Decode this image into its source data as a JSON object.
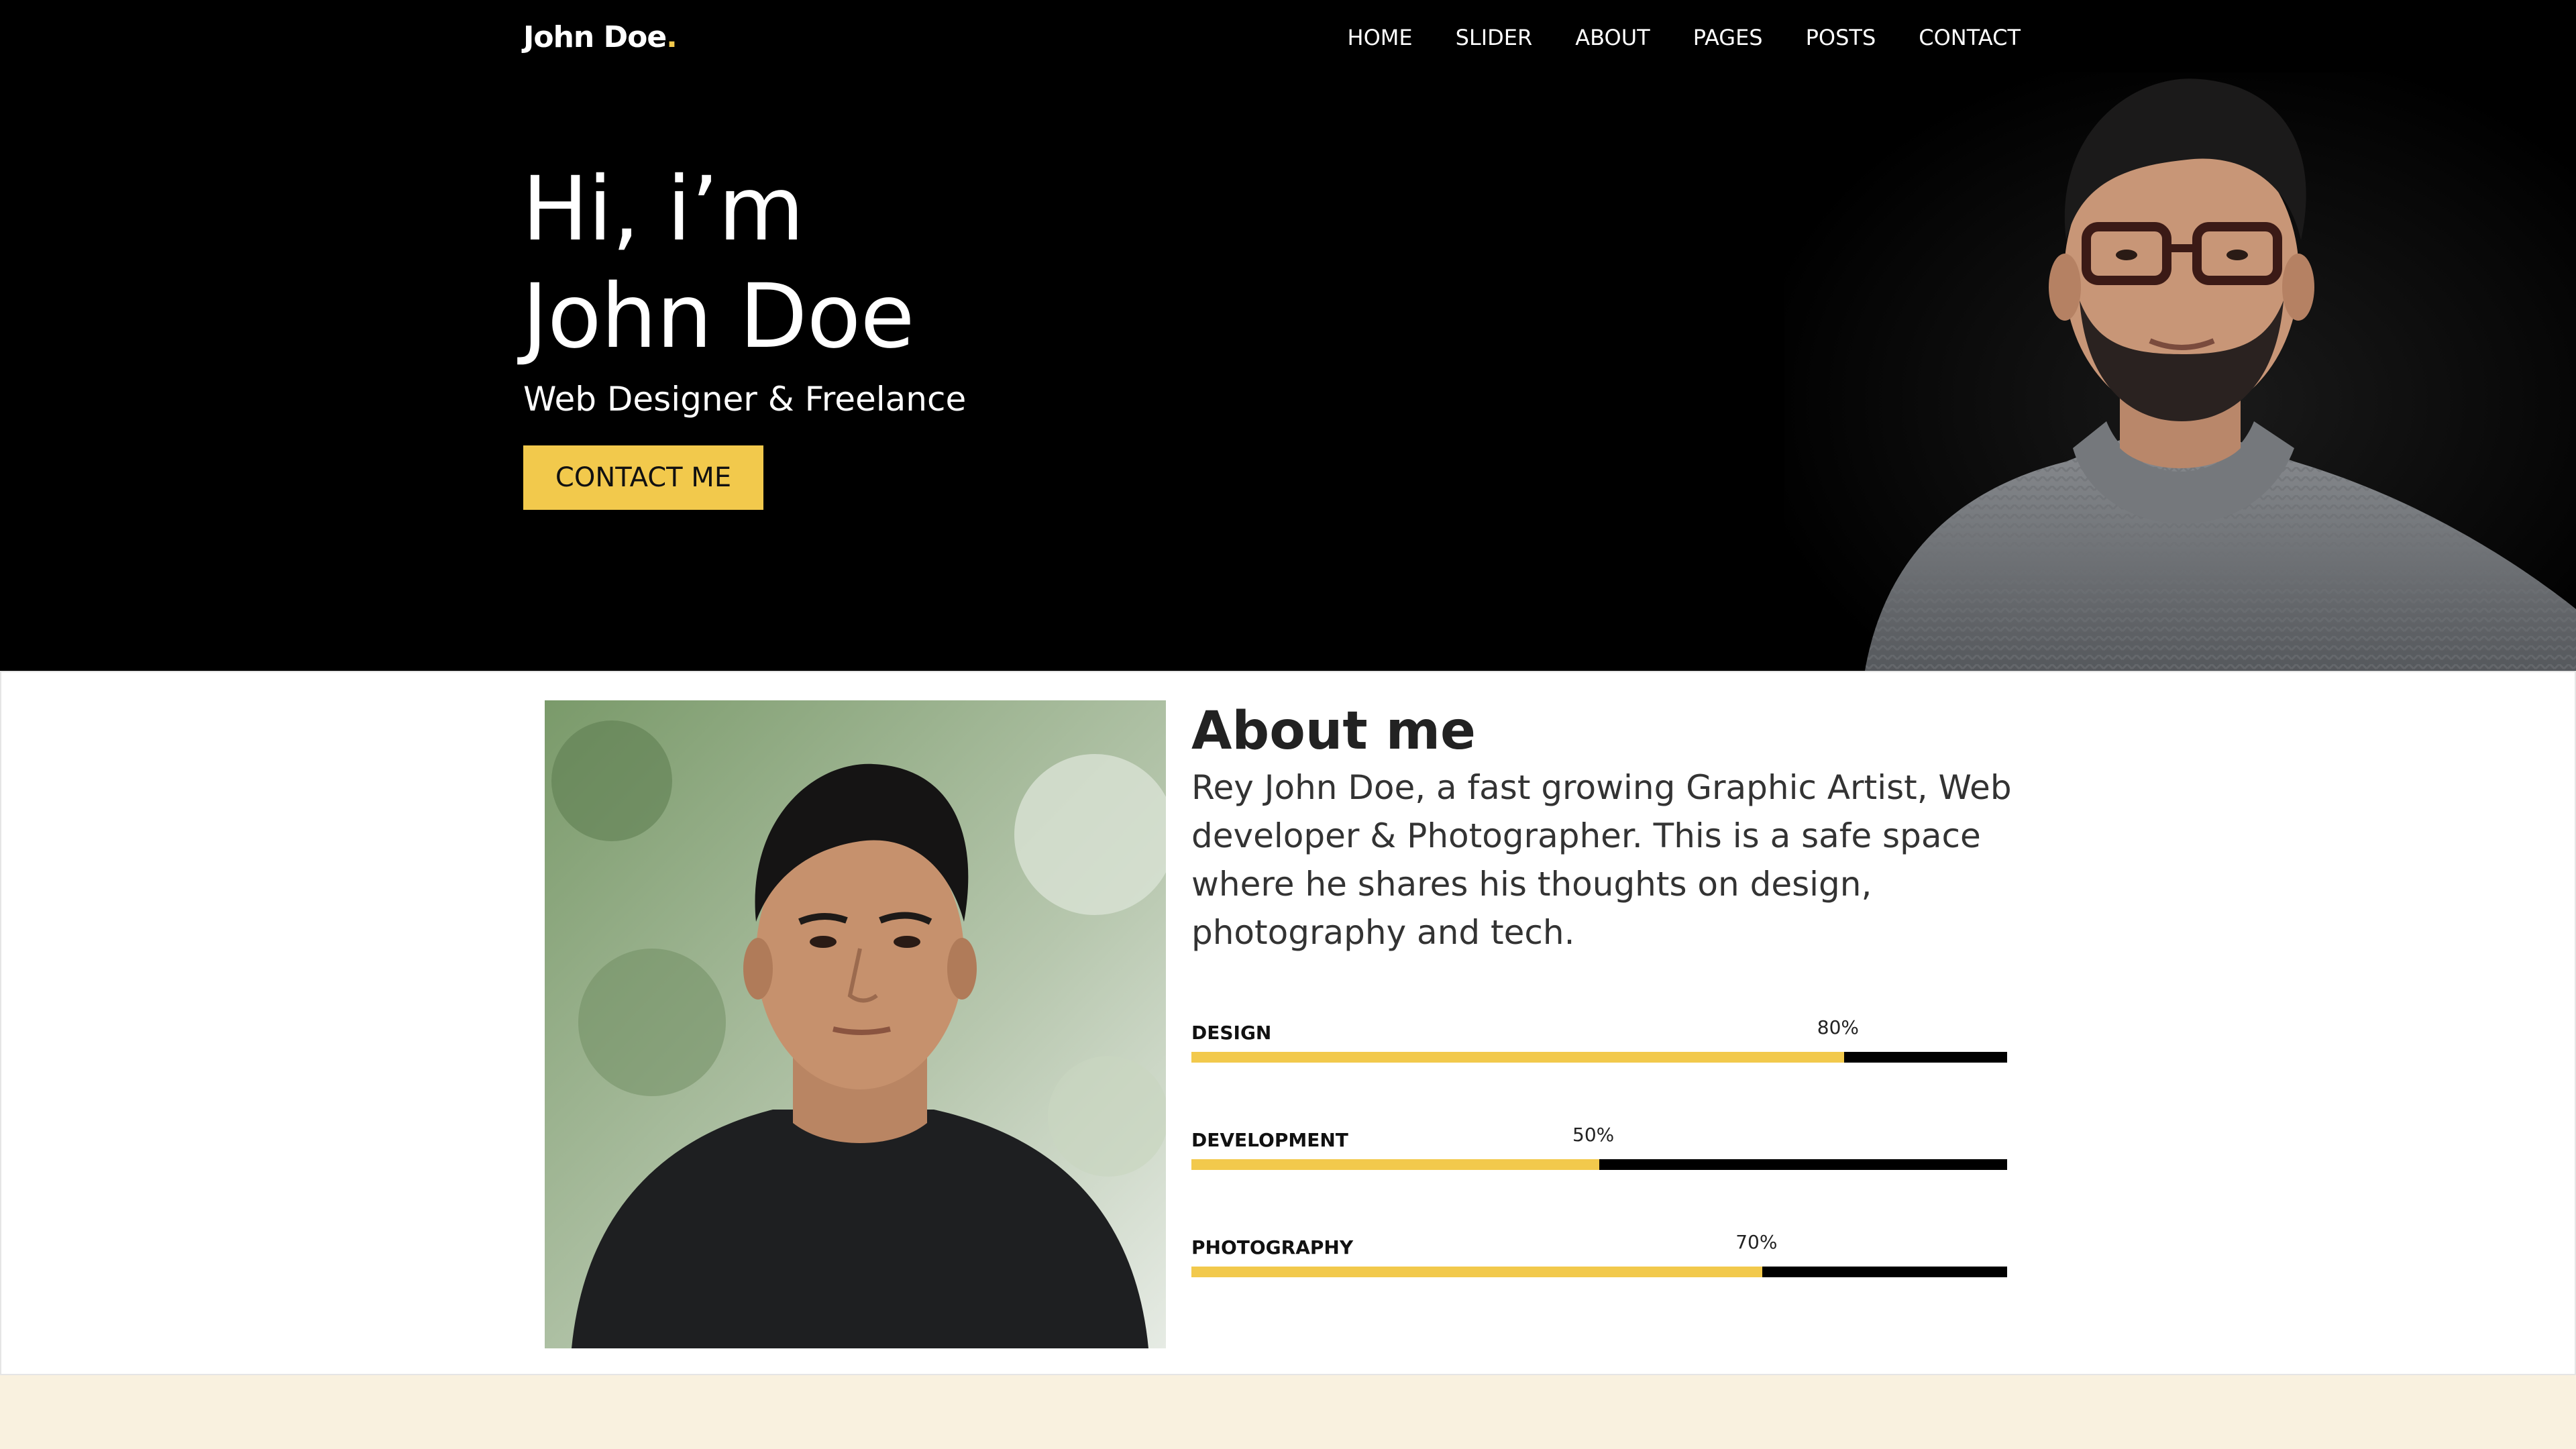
{
  "nav": {
    "logo": "John Doe",
    "logo_dot": ".",
    "links": [
      "HOME",
      "SLIDER",
      "ABOUT",
      "PAGES",
      "POSTS",
      "CONTACT"
    ]
  },
  "hero": {
    "title_line1": "Hi, i’m",
    "title_line2": "John Doe",
    "subtitle": "Web Designer & Freelance",
    "cta": "CONTACT ME"
  },
  "about": {
    "title": "About me",
    "text": "Rey John Doe, a fast growing Graphic Artist, Web developer & Photographer. This is a safe space where he shares his thoughts on design, photography and tech.",
    "skills": [
      {
        "name": "DESIGN",
        "percent_label": "80%",
        "value": 80
      },
      {
        "name": "DEVELOPMENT",
        "percent_label": "50%",
        "value": 50
      },
      {
        "name": "PHOTOGRAPHY",
        "percent_label": "70%",
        "value": 70
      }
    ]
  },
  "colors": {
    "accent": "#f2c94c",
    "hero_bg": "#000000",
    "page_bg": "#f9f1df"
  }
}
